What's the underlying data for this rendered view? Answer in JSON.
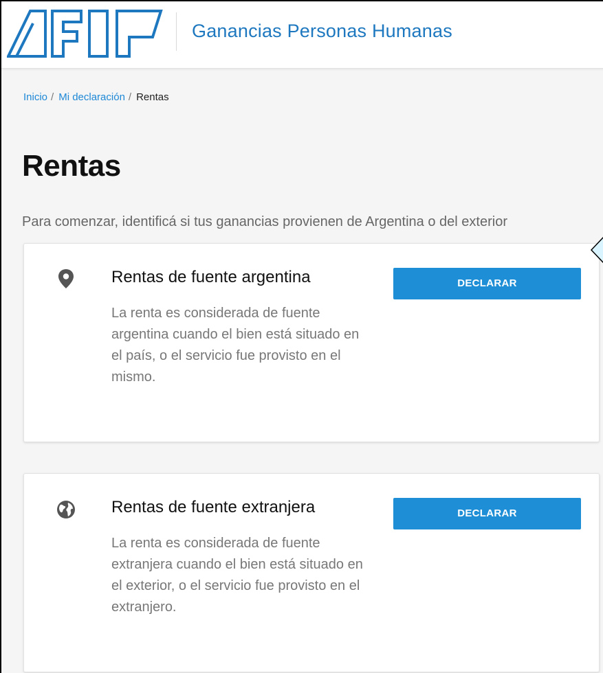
{
  "header": {
    "logo_text": "AFIP",
    "app_title": "Ganancias Personas Humanas"
  },
  "breadcrumb": {
    "items": [
      "Inicio",
      "Mi declaración"
    ],
    "separator": "/",
    "current": "Rentas"
  },
  "page": {
    "title": "Rentas",
    "intro": "Para comenzar, identificá si tus ganancias provienen de Argentina o del exterior"
  },
  "cards": [
    {
      "icon": "map-pin-icon",
      "title": "Rentas de fuente argentina",
      "description": "La renta es considerada de fuente argentina cuando el bien está situado en el país, o el servicio fue provisto en el mismo.",
      "button_label": "DECLARAR"
    },
    {
      "icon": "globe-icon",
      "title": "Rentas de fuente extranjera",
      "description": "La renta es considerada de fuente extranjera cuando el bien está situado en el exterior, o el servicio fue provisto en el extranjero.",
      "button_label": "DECLARAR"
    }
  ],
  "colors": {
    "brand_blue": "#1e78bf",
    "button_blue": "#1e8fd6",
    "link_blue": "#1e88d6",
    "icon_gray": "#555555"
  }
}
